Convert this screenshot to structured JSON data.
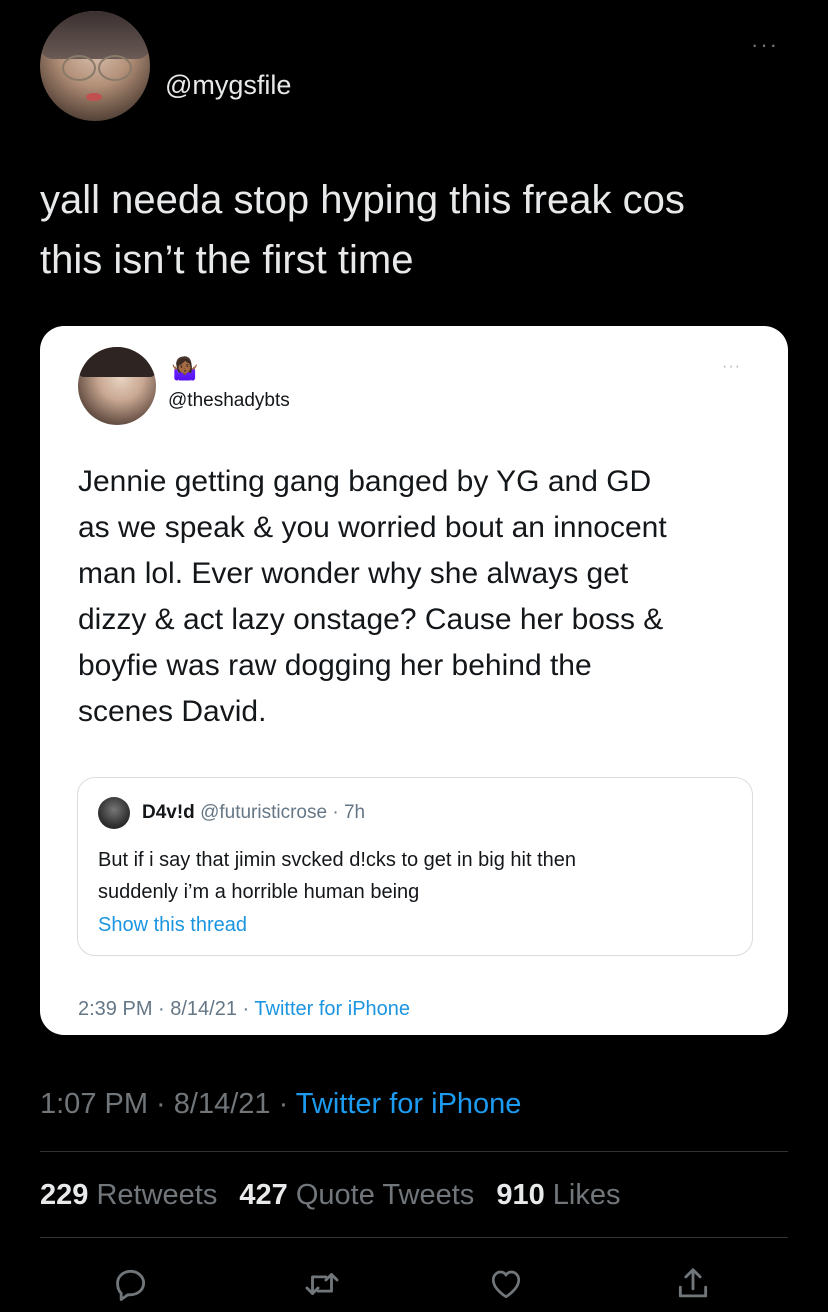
{
  "tweet": {
    "handle": "@mygsfile",
    "more": "···",
    "text": "yall needa stop hyping this freak cos\nthis isn’t the first time"
  },
  "embedded_tweet": {
    "emoji": "🤷🏾‍♀️",
    "handle": "@theshadybts",
    "more": "···",
    "text": "Jennie getting gang banged by YG and GD\nas we speak & you worried bout an innocent\nman lol. Ever wonder why she always get\ndizzy & act lazy onstage? Cause her boss &\nboyfie was raw dogging her behind the\nscenes David.",
    "quoted": {
      "name": "D4v!d",
      "meta": "@futuristicrose · 7h",
      "text": "But if i say that jimin svcked d!cks to get in big hit then\nsuddenly i’m a horrible human being",
      "link": "Show this thread"
    },
    "footer_time": "2:39 PM · 8/14/21 · ",
    "footer_source": "Twitter for iPhone"
  },
  "meta": {
    "time": "1:07 PM · 8/14/21 · ",
    "source": "Twitter for iPhone"
  },
  "stats": {
    "retweets_count": "229",
    "retweets_label": "Retweets",
    "quotes_count": "427",
    "quotes_label": "Quote Tweets",
    "likes_count": "910",
    "likes_label": "Likes"
  },
  "actions": {
    "icons": [
      "reply-icon",
      "retweet-icon",
      "like-icon",
      "share-icon"
    ]
  },
  "colors": {
    "background": "#000000",
    "text": "#e7e9ea",
    "secondary": "#71767b",
    "accent": "#1d9bf0",
    "card": "#ffffff"
  }
}
